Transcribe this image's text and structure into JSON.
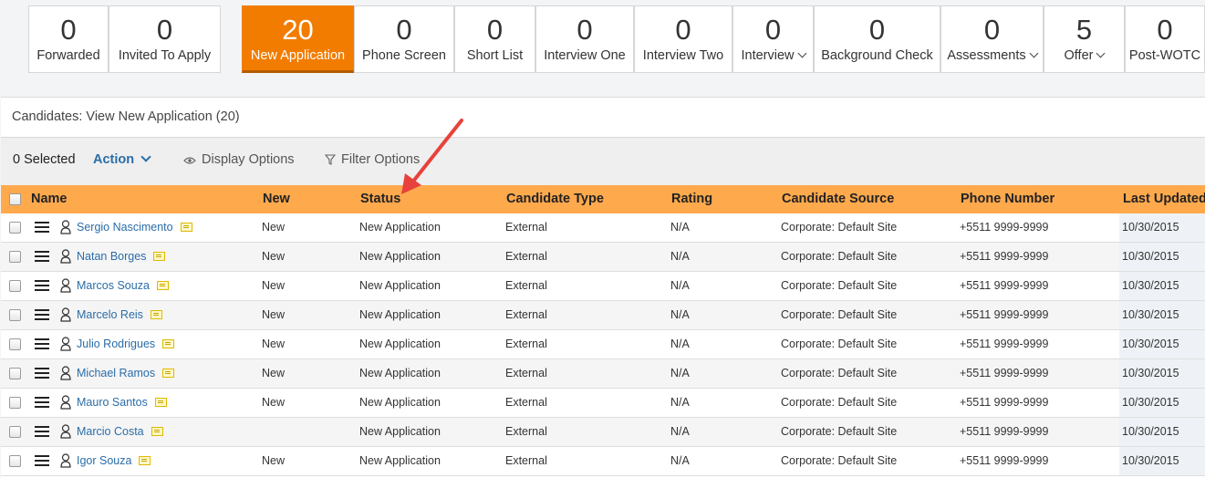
{
  "pipeline": [
    {
      "count": "0",
      "label": "Forwarded",
      "active": false,
      "dropdown": false
    },
    {
      "count": "0",
      "label": "Invited To Apply",
      "active": false,
      "dropdown": false
    },
    {
      "count": "20",
      "label": "New Application",
      "active": true,
      "dropdown": false
    },
    {
      "count": "0",
      "label": "Phone Screen",
      "active": false,
      "dropdown": false
    },
    {
      "count": "0",
      "label": "Short List",
      "active": false,
      "dropdown": false
    },
    {
      "count": "0",
      "label": "Interview One",
      "active": false,
      "dropdown": false
    },
    {
      "count": "0",
      "label": "Interview Two",
      "active": false,
      "dropdown": false
    },
    {
      "count": "0",
      "label": "Interview",
      "active": false,
      "dropdown": true
    },
    {
      "count": "0",
      "label": "Background Check",
      "active": false,
      "dropdown": false
    },
    {
      "count": "0",
      "label": "Assessments",
      "active": false,
      "dropdown": true
    },
    {
      "count": "5",
      "label": "Offer",
      "active": false,
      "dropdown": true
    },
    {
      "count": "0",
      "label": "Post-WOTC",
      "active": false,
      "dropdown": false
    }
  ],
  "panel": {
    "title": "Candidates:  View New Application (20)"
  },
  "toolbar": {
    "selected": "0 Selected",
    "action": "Action",
    "display_options": "Display Options",
    "filter_options": "Filter Options"
  },
  "columns": [
    "Name",
    "New",
    "Status",
    "Candidate Type",
    "Rating",
    "Candidate Source",
    "Phone Number",
    "Last Updated"
  ],
  "rows": [
    {
      "name": "Sergio Nascimento",
      "new": "New",
      "status": "New Application",
      "type": "External",
      "rating": "N/A",
      "source": "Corporate: Default Site",
      "phone": "+5511 9999-9999",
      "updated": "10/30/2015"
    },
    {
      "name": "Natan Borges",
      "new": "New",
      "status": "New Application",
      "type": "External",
      "rating": "N/A",
      "source": "Corporate: Default Site",
      "phone": "+5511 9999-9999",
      "updated": "10/30/2015"
    },
    {
      "name": "Marcos Souza",
      "new": "New",
      "status": "New Application",
      "type": "External",
      "rating": "N/A",
      "source": "Corporate: Default Site",
      "phone": "+5511 9999-9999",
      "updated": "10/30/2015"
    },
    {
      "name": "Marcelo Reis",
      "new": "New",
      "status": "New Application",
      "type": "External",
      "rating": "N/A",
      "source": "Corporate: Default Site",
      "phone": "+5511 9999-9999",
      "updated": "10/30/2015"
    },
    {
      "name": "Julio Rodrigues",
      "new": "New",
      "status": "New Application",
      "type": "External",
      "rating": "N/A",
      "source": "Corporate: Default Site",
      "phone": "+5511 9999-9999",
      "updated": "10/30/2015"
    },
    {
      "name": "Michael Ramos",
      "new": "New",
      "status": "New Application",
      "type": "External",
      "rating": "N/A",
      "source": "Corporate: Default Site",
      "phone": "+5511 9999-9999",
      "updated": "10/30/2015"
    },
    {
      "name": "Mauro Santos",
      "new": "New",
      "status": "New Application",
      "type": "External",
      "rating": "N/A",
      "source": "Corporate: Default Site",
      "phone": "+5511 9999-9999",
      "updated": "10/30/2015"
    },
    {
      "name": "Marcio Costa",
      "new": "",
      "status": "New Application",
      "type": "External",
      "rating": "N/A",
      "source": "Corporate: Default Site",
      "phone": "+5511 9999-9999",
      "updated": "10/30/2015"
    },
    {
      "name": "Igor Souza",
      "new": "New",
      "status": "New Application",
      "type": "External",
      "rating": "N/A",
      "source": "Corporate: Default Site",
      "phone": "+5511 9999-9999",
      "updated": "10/30/2015"
    }
  ],
  "colors": {
    "accent": "#f27c00",
    "header_row": "#ffa94d",
    "link": "#2a6da8",
    "annotation_arrow": "#e8413c"
  },
  "icons": [
    "eye-icon",
    "filter-icon",
    "menu-icon",
    "person-icon",
    "card-icon",
    "chevron-down-icon",
    "checkbox-icon",
    "arrow-annotation"
  ]
}
